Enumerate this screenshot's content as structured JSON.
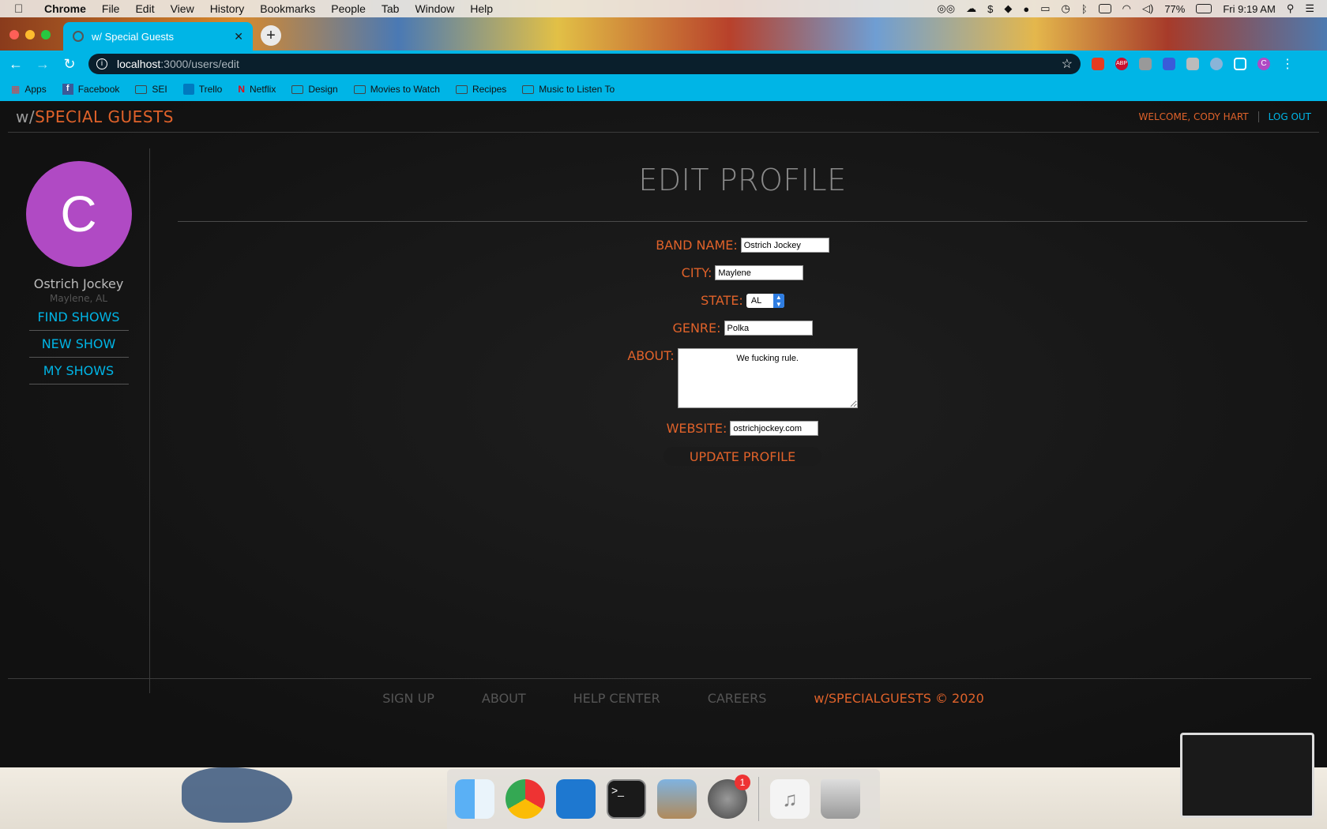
{
  "menubar": {
    "app": "Chrome",
    "items": [
      "File",
      "Edit",
      "View",
      "History",
      "Bookmarks",
      "People",
      "Tab",
      "Window",
      "Help"
    ],
    "battery": "77%",
    "clock": "Fri 9:19 AM"
  },
  "browser": {
    "tab_title": "w/ Special Guests",
    "url_host": "localhost",
    "url_path": ":3000/users/edit",
    "bookmarks": [
      "Apps",
      "Facebook",
      "SEI",
      "Trello",
      "Netflix",
      "Design",
      "Movies to Watch",
      "Recipes",
      "Music to Listen To"
    ],
    "profile_initial": "C",
    "ext_abp": "ABP"
  },
  "site": {
    "logo_prefix": "w/",
    "logo_name": "SPECIAL GUESTS",
    "welcome": "WELCOME, CODY HART",
    "logout": "LOG OUT"
  },
  "sidebar": {
    "avatar_initial": "C",
    "name": "Ostrich Jockey",
    "location": "Maylene, AL",
    "links": [
      "FIND SHOWS",
      "NEW SHOW",
      "MY SHOWS"
    ]
  },
  "form": {
    "title": "EDIT PROFILE",
    "band_name_label": "BAND NAME:",
    "band_name_value": "Ostrich Jockey",
    "city_label": "CITY:",
    "city_value": "Maylene",
    "state_label": "STATE:",
    "state_value": "AL",
    "genre_label": "GENRE:",
    "genre_value": "Polka",
    "about_label": "ABOUT:",
    "about_value": "We fucking rule.",
    "website_label": "WEBSITE:",
    "website_value": "ostrichjockey.com",
    "submit_label": "UPDATE PROFILE"
  },
  "footer": {
    "links": [
      "SIGN UP",
      "ABOUT",
      "HELP CENTER",
      "CAREERS"
    ],
    "copyright": "w/SPECIALGUESTS © 2020"
  },
  "dock": {
    "apps": [
      "Finder",
      "Chrome",
      "VS Code",
      "Terminal",
      "Preview",
      "System Preferences",
      "Music",
      "Trash"
    ],
    "prefs_badge": "1"
  }
}
